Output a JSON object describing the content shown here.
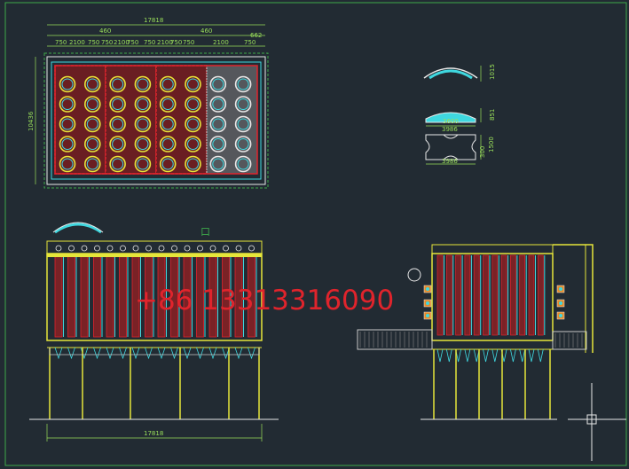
{
  "plan": {
    "overall_width": "17818",
    "overall_height": "10436",
    "dims_top": [
      "750",
      "2100",
      "750",
      "750",
      "2100",
      "750",
      "750",
      "2100",
      "750",
      "750",
      "2100",
      "750"
    ],
    "dim_460_a": "460",
    "dim_460_b": "460",
    "dim_662": "662",
    "cell_rows": 5,
    "cell_cols": 8
  },
  "detail": {
    "arc_height": "1015",
    "plate_height": "851",
    "plate_width_inner": "3600",
    "plate_width_outer": "3986",
    "block_dim_a": "300",
    "block_dim_b": "1500",
    "block_width": "3986"
  },
  "front_view": {
    "bottom_width": "17818",
    "marker": "口"
  },
  "watermark": {
    "text": "+86 13313316090"
  },
  "colors": {
    "background": "#222b33",
    "dimension": "#9adf5a",
    "frame_yellow": "#e6e63a",
    "filter_red": "#c0332f",
    "cyan": "#3fd8e0",
    "white_line": "#e8e8e8",
    "watermark_red": "#e0242c"
  }
}
